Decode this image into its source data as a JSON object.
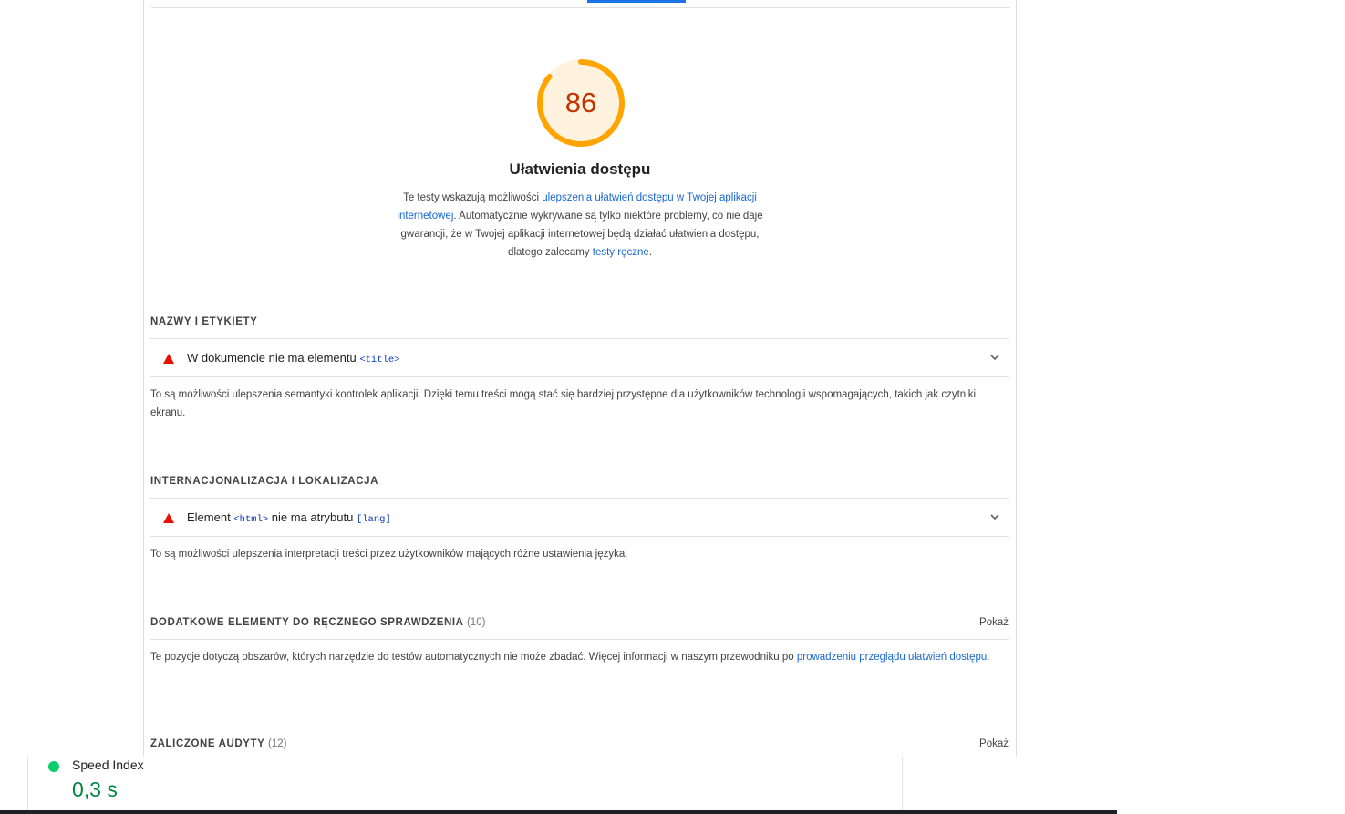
{
  "score": {
    "value": "86",
    "fraction": 0.86,
    "color": "#c33300",
    "ring_color": "#ffa400",
    "fill_color": "#fff3e0"
  },
  "category": {
    "title": "Ułatwienia dostępu",
    "desc_part1": "Te testy wskazują możliwości ",
    "desc_link1": "ulepszenia ułatwień dostępu w Twojej aplikacji internetowej",
    "desc_part2": ". Automatycznie wykrywane są tylko niektóre problemy, co nie daje gwarancji, że w Twojej aplikacji internetowej będą działać ułatwienia dostępu, dlatego zalecamy ",
    "desc_link2": "testy ręczne",
    "desc_part3": "."
  },
  "groups": [
    {
      "title": "NAZWY I ETYKIETY",
      "audit_text": "W dokumencie nie ma elementu ",
      "audit_code": "<title>",
      "description": "To są możliwości ulepszenia semantyki kontrolek aplikacji. Dzięki temu treści mogą stać się bardziej przystępne dla użytkowników technologii wspomagających, takich jak czytniki ekranu."
    },
    {
      "title": "INTERNACJONALIZACJA I LOKALIZACJA",
      "audit_text1": "Element ",
      "audit_code1": "<html>",
      "audit_text2": " nie ma atrybutu ",
      "audit_code2": "[lang]",
      "description": "To są możliwości ulepszenia interpretacji treści przez użytkowników mających różne ustawienia języka."
    },
    {
      "title": "DODATKOWE ELEMENTY DO RĘCZNEGO SPRAWDZENIA",
      "count": "(10)",
      "show_label": "Pokaż",
      "desc_part1": "Te pozycje dotyczą obszarów, których narzędzie do testów automatycznych nie może zbadać. Więcej informacji w naszym przewodniku po ",
      "desc_link": "prowadzeniu przeglądu ułatwień dostępu",
      "desc_part2": "."
    },
    {
      "title": "ZALICZONE AUDYTY",
      "count": "(12)",
      "show_label": "Pokaż"
    }
  ],
  "metric": {
    "label": "Speed Index",
    "value": "0,3 s",
    "status_color": "#0cce6b"
  },
  "icons": {
    "fail": "red-triangle-icon",
    "expand": "chevron-down-icon",
    "pass": "green-circle-icon"
  }
}
